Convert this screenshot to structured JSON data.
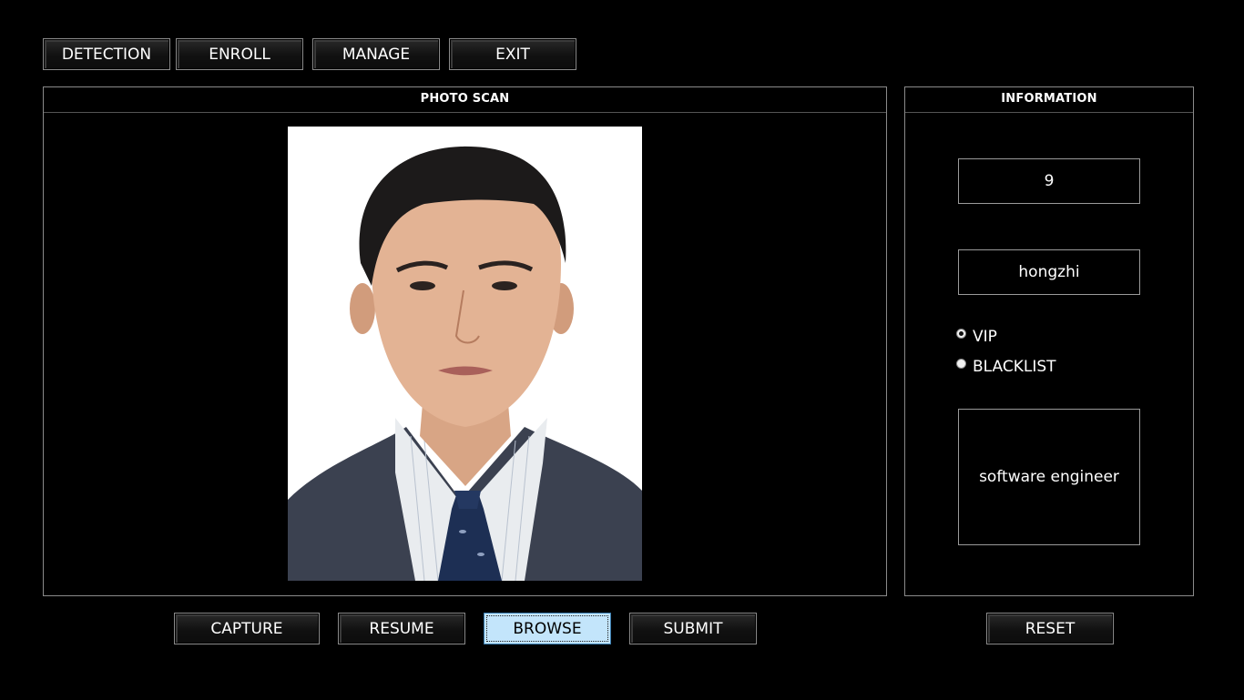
{
  "toolbar": {
    "detection": "DETECTION",
    "enroll": "ENROLL",
    "manage": "MANAGE",
    "exit": "EXIT"
  },
  "photo_panel": {
    "title": "PHOTO SCAN"
  },
  "info_panel": {
    "title": "INFORMATION",
    "id_value": "9",
    "name_value": "hongzhi",
    "radio_vip": "VIP",
    "radio_blacklist": "BLACKLIST",
    "selected": "VIP",
    "description": "software engineer"
  },
  "actions": {
    "capture": "CAPTURE",
    "resume": "RESUME",
    "browse": "BROWSE",
    "submit": "SUBMIT",
    "reset": "RESET"
  }
}
